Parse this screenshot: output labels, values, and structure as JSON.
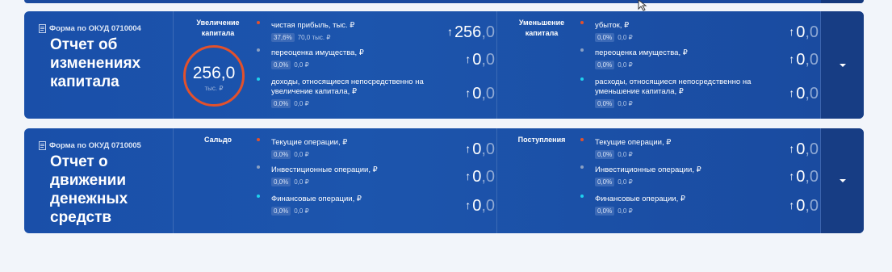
{
  "colors": {
    "red": "#e2512c",
    "gray": "#8aa0c3",
    "cyan": "#1ed1ee"
  },
  "cards": [
    {
      "form_label": "Форма по ОКУД 0710004",
      "title": "Отчет об изменениях капитала",
      "left_section": {
        "label": "Увеличение капитала",
        "gauge": {
          "value": "256,0",
          "unit": "тыс. ₽"
        },
        "rows": [
          {
            "label": "чистая прибыль, тыс. ₽",
            "pct": "37,6%",
            "sub": "70,0 тыс. ₽",
            "value_int": "256",
            "value_frac": ",0",
            "dot": "red"
          },
          {
            "label": "переоценка имущества, ₽",
            "pct": "0,0%",
            "sub": "0,0 ₽",
            "value_int": "0",
            "value_frac": ",0",
            "dot": "gray"
          },
          {
            "label": "доходы, относящиеся непосредственно на увеличение капитала, ₽",
            "pct": "0,0%",
            "sub": "0,0 ₽",
            "value_int": "0",
            "value_frac": ",0",
            "dot": "cyan"
          }
        ]
      },
      "right_section": {
        "label": "Уменьшение капитала",
        "rows": [
          {
            "label": "убыток, ₽",
            "pct": "0,0%",
            "sub": "0,0 ₽",
            "value_int": "0",
            "value_frac": ",0",
            "dot": "red"
          },
          {
            "label": "переоценка имущества, ₽",
            "pct": "0,0%",
            "sub": "0,0 ₽",
            "value_int": "0",
            "value_frac": ",0",
            "dot": "gray"
          },
          {
            "label": "расходы, относящиеся непосредственно на уменьшение капитала, ₽",
            "pct": "0,0%",
            "sub": "0,0 ₽",
            "value_int": "0",
            "value_frac": ",0",
            "dot": "cyan"
          }
        ]
      }
    },
    {
      "form_label": "Форма по ОКУД 0710005",
      "title": "Отчет о движении денежных средств",
      "left_section": {
        "label": "Сальдо",
        "rows": [
          {
            "label": "Текущие операции, ₽",
            "pct": "0,0%",
            "sub": "0,0 ₽",
            "value_int": "0",
            "value_frac": ",0",
            "dot": "red"
          },
          {
            "label": "Инвестиционные операции, ₽",
            "pct": "0,0%",
            "sub": "0,0 ₽",
            "value_int": "0",
            "value_frac": ",0",
            "dot": "gray"
          },
          {
            "label": "Финансовые операции, ₽",
            "pct": "0,0%",
            "sub": "0,0 ₽",
            "value_int": "0",
            "value_frac": ",0",
            "dot": "cyan"
          }
        ]
      },
      "right_section": {
        "label": "Поступления",
        "rows": [
          {
            "label": "Текущие операции, ₽",
            "pct": "0,0%",
            "sub": "0,0 ₽",
            "value_int": "0",
            "value_frac": ",0",
            "dot": "red"
          },
          {
            "label": "Инвестиционные операции, ₽",
            "pct": "0,0%",
            "sub": "0,0 ₽",
            "value_int": "0",
            "value_frac": ",0",
            "dot": "gray"
          },
          {
            "label": "Финансовые операции, ₽",
            "pct": "0,0%",
            "sub": "0,0 ₽",
            "value_int": "0",
            "value_frac": ",0",
            "dot": "cyan"
          }
        ]
      }
    }
  ]
}
